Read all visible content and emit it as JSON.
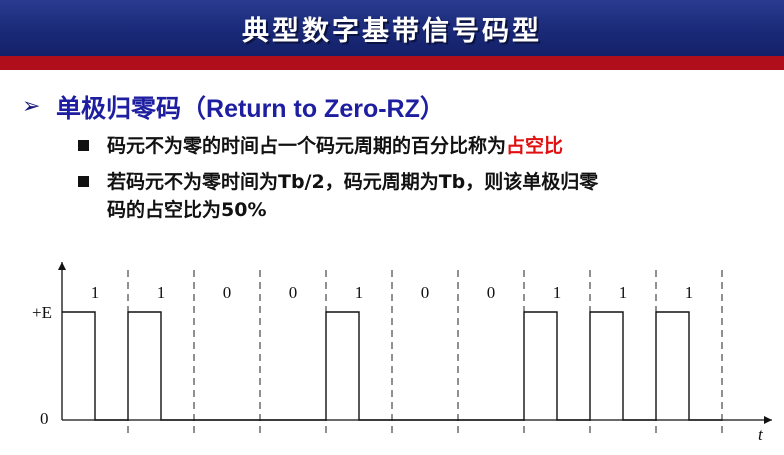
{
  "title": "典型数字基带信号码型",
  "heading": {
    "arrow_icon": "arrow-right-icon",
    "cn": "单极归零码",
    "en": "（Return to Zero-RZ）"
  },
  "bullets": [
    {
      "text": "码元不为零的时间占一个码元周期的百分比称为",
      "highlight": "占空比",
      "highlight_color": "#e01010"
    },
    {
      "line1": "若码元不为零时间为Tb/2，码元周期为Tb，则该单极归零",
      "line2": "码的占空比为50%"
    }
  ],
  "diagram": {
    "bits": [
      "1",
      "1",
      "0",
      "0",
      "1",
      "0",
      "0",
      "1",
      "1",
      "1"
    ],
    "high_label": "+E",
    "zero_label": "0",
    "time_label": "t",
    "duty_cycle": 0.5
  },
  "colors": {
    "title_bar": "#1a2a78",
    "stripe": "#b00e1a",
    "heading": "#1e1ea0"
  }
}
